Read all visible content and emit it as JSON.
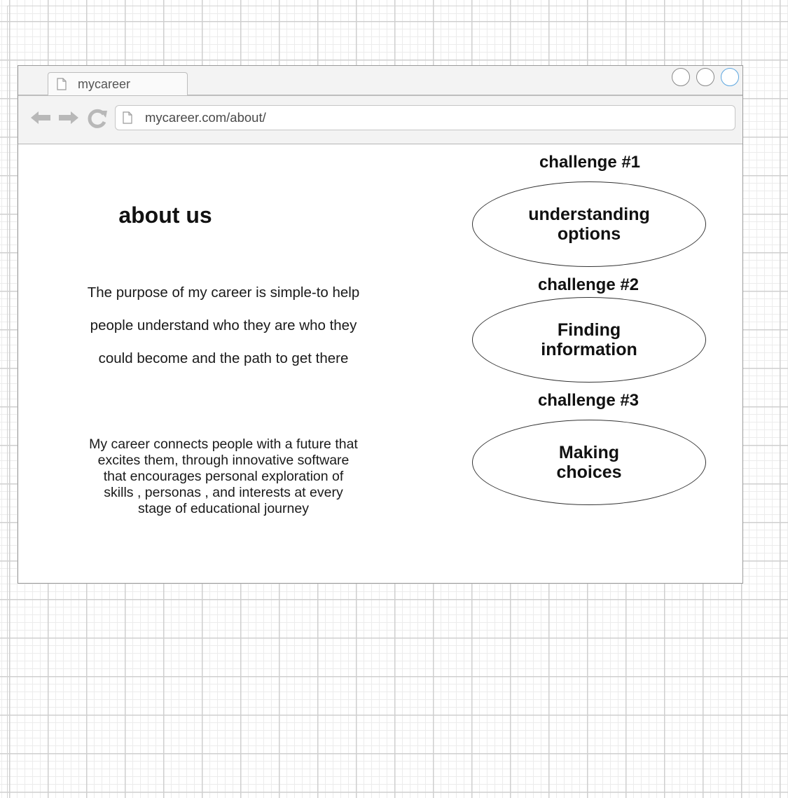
{
  "browser": {
    "tab_title": "mycareer",
    "url": "mycareer.com/about/",
    "icons": {
      "back": "arrow-left-icon",
      "forward": "arrow-right-icon",
      "reload": "reload-icon",
      "page": "page-icon"
    },
    "accent_color": "#5ea7e0"
  },
  "main": {
    "title": "about us",
    "purpose_lines": [
      "The purpose of my career is simple-to help",
      "people understand who they are who they",
      "could become and the path to get there"
    ],
    "mission_lines": [
      "My career connects people with a future that",
      "excites them, through innovative software",
      "that encourages personal exploration of",
      "skills , personas , and interests at every",
      "stage of educational journey"
    ]
  },
  "challenges": [
    {
      "label": "challenge #1",
      "lines": [
        "understanding",
        "options"
      ]
    },
    {
      "label": "challenge #2",
      "lines": [
        "Finding",
        "information"
      ]
    },
    {
      "label": "challenge #3",
      "lines": [
        "Making",
        "choices"
      ]
    }
  ]
}
